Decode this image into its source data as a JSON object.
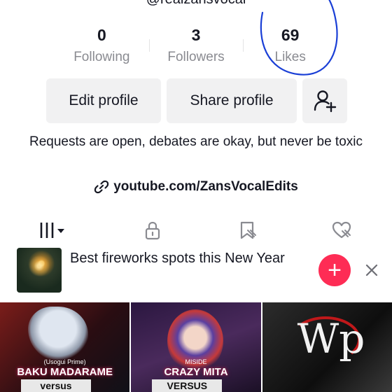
{
  "profile": {
    "username": "@realzansvocal",
    "stats": [
      {
        "value": "0",
        "label": "Following"
      },
      {
        "value": "3",
        "label": "Followers"
      },
      {
        "value": "69",
        "label": "Likes"
      }
    ],
    "edit_label": "Edit profile",
    "share_label": "Share profile",
    "add_friend_icon": "person-add-icon",
    "bio": "Requests are open, debates are okay, but never be toxic",
    "link_text": "youtube.com/ZansVocalEdits"
  },
  "tabs": [
    {
      "icon": "grid-videos-icon",
      "active": true
    },
    {
      "icon": "lock-icon",
      "active": false
    },
    {
      "icon": "bookmark-icon",
      "active": false
    },
    {
      "icon": "liked-heart-icon",
      "active": false
    }
  ],
  "banner": {
    "text": "Best fireworks spots this New Year",
    "plus_glyph": "+",
    "accent": "#fe2c55"
  },
  "videos": [
    {
      "sub": "(Usogui Prime)",
      "caption": "BAKU MADARAME",
      "tag": "versus"
    },
    {
      "sub": "MISIDE",
      "caption": "CRAZY MITA",
      "tag": "VERSUS"
    },
    {
      "logo": "Wp"
    }
  ],
  "annotation": {
    "color": "#1a3fd6"
  }
}
